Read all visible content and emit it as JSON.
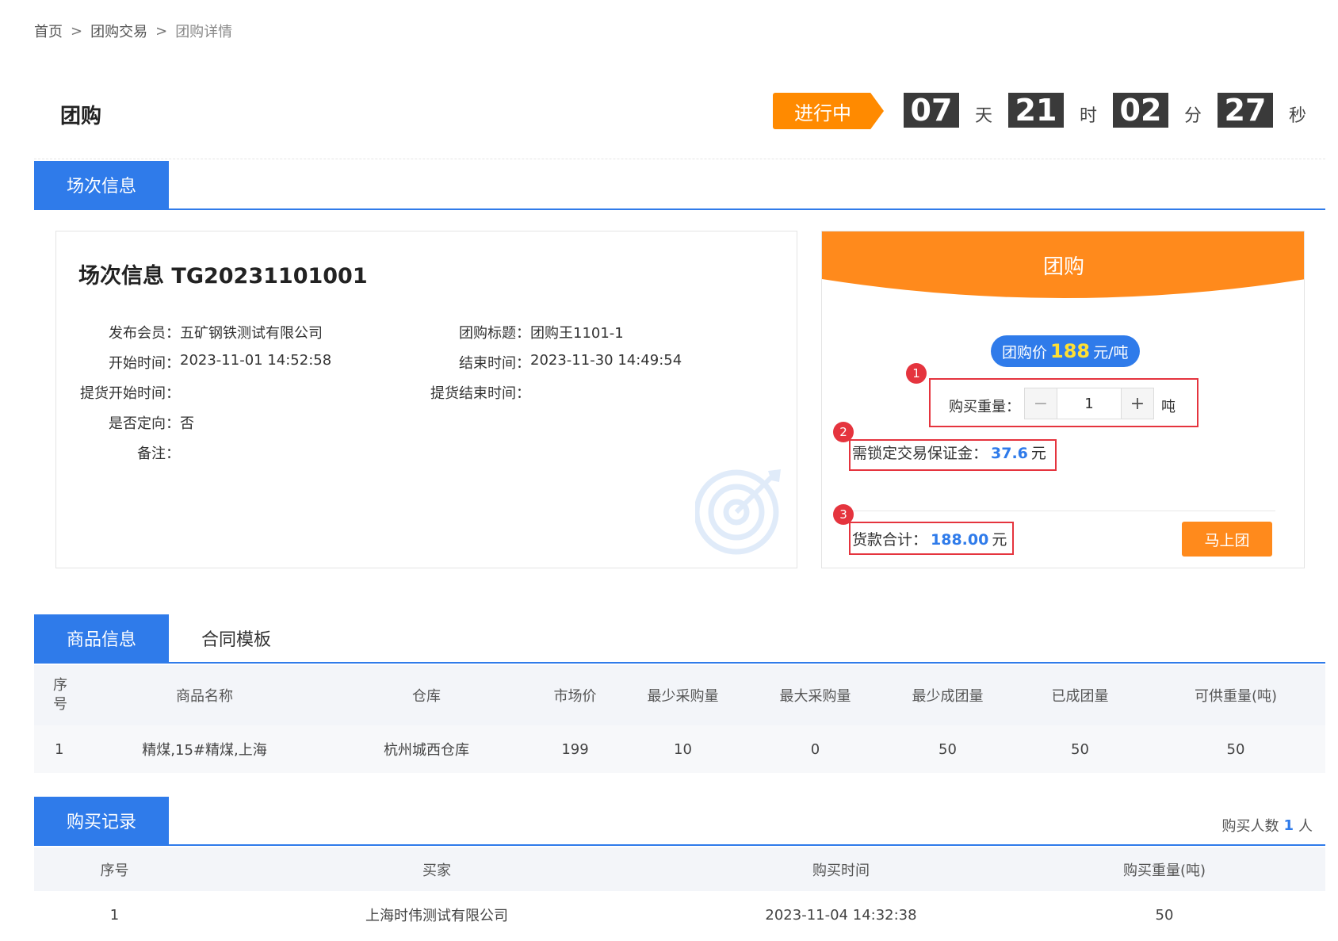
{
  "breadcrumb": {
    "home": "首页",
    "sep": ">",
    "level2": "团购交易",
    "current": "团购详情"
  },
  "header": {
    "title": "团购",
    "status": "进行中",
    "countdown": [
      {
        "value": "07",
        "unit": "天"
      },
      {
        "value": "21",
        "unit": "时"
      },
      {
        "value": "02",
        "unit": "分"
      },
      {
        "value": "27",
        "unit": "秒"
      }
    ]
  },
  "session_tabs": {
    "active": "场次信息"
  },
  "session": {
    "title": "场次信息 TG20231101001",
    "fields": {
      "publisher_label": "发布会员：",
      "publisher": "五矿钢铁测试有限公司",
      "group_title_label": "团购标题：",
      "group_title": "团购王1101-1",
      "start_label": "开始时间：",
      "start": "2023-11-01 14:52:58",
      "end_label": "结束时间：",
      "end": "2023-11-30 14:49:54",
      "pickup_start_label": "提货开始时间：",
      "pickup_start": "",
      "pickup_end_label": "提货结束时间：",
      "pickup_end": "",
      "directed_label": "是否定向：",
      "directed": "否",
      "remark_label": "备注：",
      "remark": ""
    }
  },
  "buy": {
    "title": "团购",
    "price_prefix": "团购价",
    "price": "188",
    "price_unit": "元/吨",
    "qty_label": "购买重量：",
    "qty": "1",
    "qty_unit": "吨",
    "minus": "−",
    "plus": "+",
    "deposit_label": "需锁定交易保证金：",
    "deposit": "37.6",
    "deposit_unit": "元",
    "total_label": "货款合计：",
    "total": "188.00",
    "total_unit": "元",
    "join_label": "马上团",
    "badges": [
      "1",
      "2",
      "3"
    ]
  },
  "goods_tabs": {
    "active": "商品信息",
    "other": "合同模板"
  },
  "goods_table": {
    "headers": [
      "序号",
      "商品名称",
      "仓库",
      "市场价",
      "最少采购量",
      "最大采购量",
      "最少成团量",
      "已成团量",
      "可供重量(吨)"
    ],
    "rows": [
      [
        "1",
        "精煤,15#精煤,上海",
        "杭州城西仓库",
        "199",
        "10",
        "0",
        "50",
        "50",
        "50"
      ]
    ]
  },
  "records_tabs": {
    "active": "购买记录",
    "count_prefix": "购买人数",
    "count": "1",
    "count_unit": "人"
  },
  "records_table": {
    "headers": [
      "序号",
      "买家",
      "购买时间",
      "购买重量(吨)"
    ],
    "rows": [
      [
        "1",
        "上海时伟测试有限公司",
        "2023-11-04 14:32:38",
        "50"
      ]
    ]
  },
  "colors": {
    "primary": "#2f7bea",
    "accent": "#ff8a00",
    "highlight_box": "#e5343e",
    "price_highlight": "#ffe033"
  },
  "icons": {
    "watermark": "target-icon"
  }
}
